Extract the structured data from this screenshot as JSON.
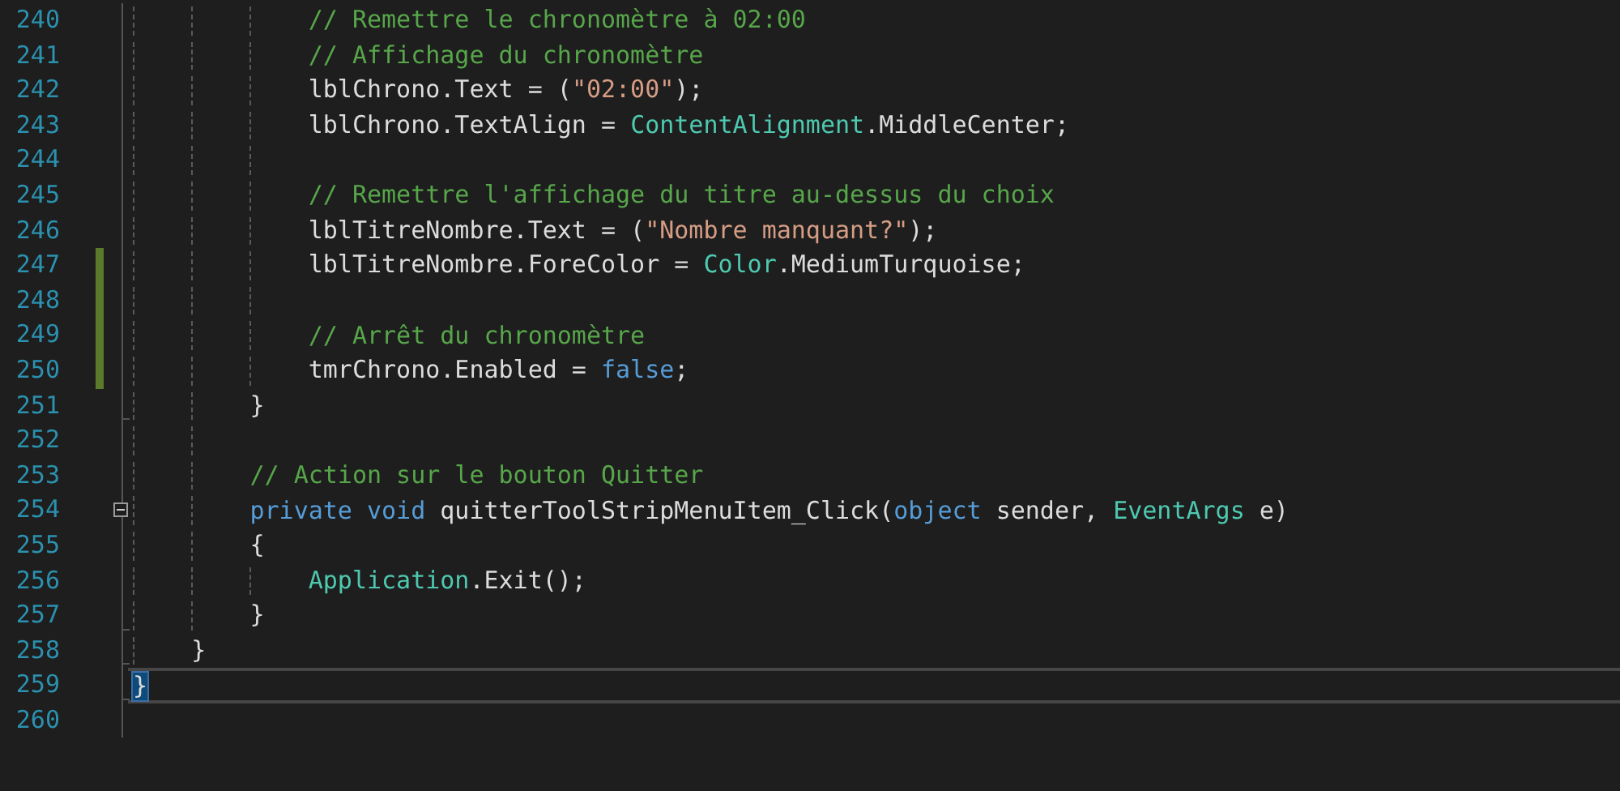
{
  "editor": {
    "lines": [
      {
        "number": "240",
        "changed": false,
        "current": false,
        "collapsible": false,
        "fold_end": false,
        "brace_highlighted": false,
        "tokens": [
          {
            "text": "            // Remettre le chronomètre à 02:00",
            "kind": "comment"
          }
        ]
      },
      {
        "number": "241",
        "changed": false,
        "current": false,
        "collapsible": false,
        "fold_end": false,
        "brace_highlighted": false,
        "tokens": [
          {
            "text": "            // Affichage du chronomètre",
            "kind": "comment"
          }
        ]
      },
      {
        "number": "242",
        "changed": false,
        "current": false,
        "collapsible": false,
        "fold_end": false,
        "brace_highlighted": false,
        "tokens": [
          {
            "text": "            lblChrono.Text = (",
            "kind": "plain"
          },
          {
            "text": "\"02:00\"",
            "kind": "string"
          },
          {
            "text": ");",
            "kind": "plain"
          }
        ]
      },
      {
        "number": "243",
        "changed": false,
        "current": false,
        "collapsible": false,
        "fold_end": false,
        "brace_highlighted": false,
        "tokens": [
          {
            "text": "            lblChrono.TextAlign = ",
            "kind": "plain"
          },
          {
            "text": "ContentAlignment",
            "kind": "type"
          },
          {
            "text": ".MiddleCenter;",
            "kind": "plain"
          }
        ]
      },
      {
        "number": "244",
        "changed": false,
        "current": false,
        "collapsible": false,
        "fold_end": false
      },
      {
        "number": "245",
        "changed": false,
        "current": false,
        "collapsible": false,
        "fold_end": false,
        "brace_highlighted": false,
        "tokens": [
          {
            "text": "            // Remettre l'affichage du titre au-dessus du choix",
            "kind": "comment"
          }
        ]
      },
      {
        "number": "246",
        "changed": false,
        "current": false,
        "collapsible": false,
        "fold_end": false,
        "brace_highlighted": false,
        "tokens": [
          {
            "text": "            lblTitreNombre.Text = (",
            "kind": "plain"
          },
          {
            "text": "\"Nombre manquant?\"",
            "kind": "string"
          },
          {
            "text": ");",
            "kind": "plain"
          }
        ]
      },
      {
        "number": "247",
        "changed": true,
        "current": false,
        "collapsible": false,
        "fold_end": false,
        "brace_highlighted": false,
        "tokens": [
          {
            "text": "            lblTitreNombre.ForeColor = ",
            "kind": "plain"
          },
          {
            "text": "Color",
            "kind": "type"
          },
          {
            "text": ".MediumTurquoise;",
            "kind": "plain"
          }
        ]
      },
      {
        "number": "248",
        "changed": true,
        "current": false,
        "collapsible": false,
        "fold_end": false
      },
      {
        "number": "249",
        "changed": true,
        "current": false,
        "collapsible": false,
        "fold_end": false,
        "brace_highlighted": false,
        "tokens": [
          {
            "text": "            // Arrêt du chronomètre",
            "kind": "comment"
          }
        ]
      },
      {
        "number": "250",
        "changed": true,
        "current": false,
        "collapsible": false,
        "fold_end": false,
        "brace_highlighted": false,
        "tokens": [
          {
            "text": "            tmrChrono.Enabled = ",
            "kind": "plain"
          },
          {
            "text": "false",
            "kind": "keyword"
          },
          {
            "text": ";",
            "kind": "plain"
          }
        ]
      },
      {
        "number": "251",
        "changed": false,
        "current": false,
        "collapsible": false,
        "fold_end": true,
        "brace_highlighted": false,
        "tokens": [
          {
            "text": "        }",
            "kind": "plain"
          }
        ]
      },
      {
        "number": "252",
        "changed": false,
        "current": false,
        "collapsible": false,
        "fold_end": false
      },
      {
        "number": "253",
        "changed": false,
        "current": false,
        "collapsible": false,
        "fold_end": false,
        "brace_highlighted": false,
        "tokens": [
          {
            "text": "        // Action sur le bouton Quitter",
            "kind": "comment"
          }
        ]
      },
      {
        "number": "254",
        "changed": false,
        "current": false,
        "collapsible": true,
        "fold_end": false,
        "brace_highlighted": false,
        "tokens": [
          {
            "text": "        private void",
            "kind": "keyword"
          },
          {
            "text": " quitterToolStripMenuItem_Click(",
            "kind": "plain"
          },
          {
            "text": "object",
            "kind": "keyword"
          },
          {
            "text": " sender, ",
            "kind": "plain"
          },
          {
            "text": "EventArgs",
            "kind": "type"
          },
          {
            "text": " e)",
            "kind": "plain"
          }
        ]
      },
      {
        "number": "255",
        "changed": false,
        "current": false,
        "collapsible": false,
        "fold_end": false,
        "brace_highlighted": false,
        "tokens": [
          {
            "text": "        {",
            "kind": "plain"
          }
        ]
      },
      {
        "number": "256",
        "changed": false,
        "current": false,
        "collapsible": false,
        "fold_end": false,
        "brace_highlighted": false,
        "tokens": [
          {
            "text": "            Application",
            "kind": "type"
          },
          {
            "text": ".Exit();",
            "kind": "plain"
          }
        ]
      },
      {
        "number": "257",
        "changed": false,
        "current": false,
        "collapsible": false,
        "fold_end": true,
        "brace_highlighted": false,
        "tokens": [
          {
            "text": "        }",
            "kind": "plain"
          }
        ]
      },
      {
        "number": "258",
        "changed": false,
        "current": false,
        "collapsible": false,
        "fold_end": true,
        "brace_highlighted": false,
        "tokens": [
          {
            "text": "    }",
            "kind": "plain"
          }
        ]
      },
      {
        "number": "259",
        "changed": false,
        "current": true,
        "collapsible": false,
        "fold_end": true,
        "brace_highlighted": true,
        "tokens": [
          {
            "text": "}",
            "kind": "plain"
          }
        ]
      },
      {
        "number": "260",
        "changed": false,
        "current": false,
        "collapsible": false,
        "fold_end": false
      }
    ]
  }
}
